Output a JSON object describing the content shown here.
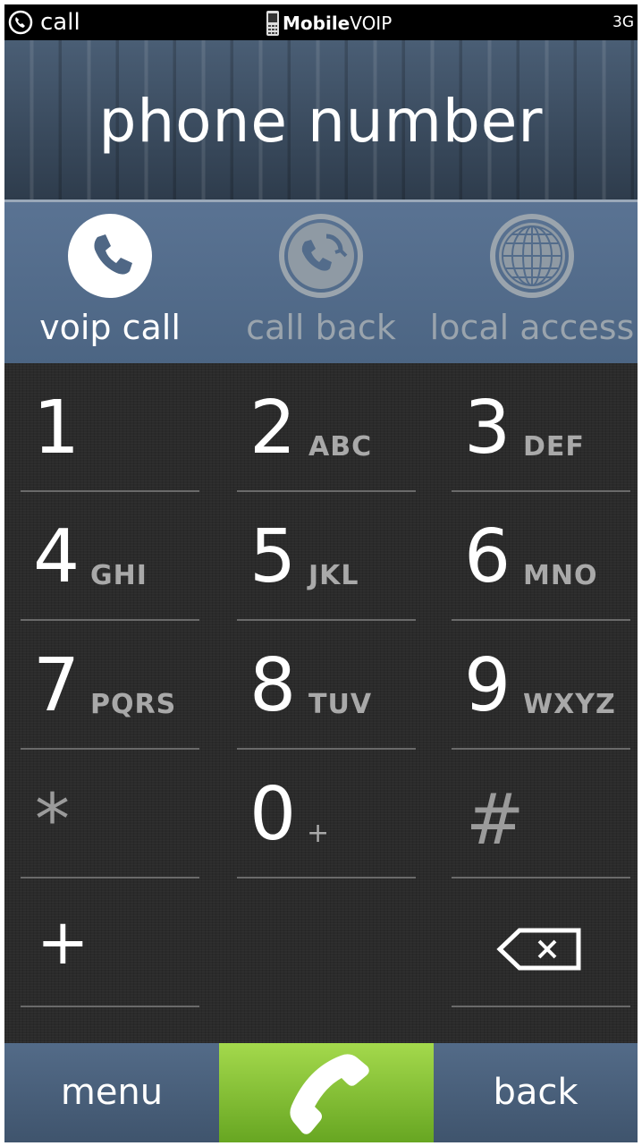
{
  "status_bar": {
    "app_label": "call",
    "brand_bold": "Mobile",
    "brand_light": "VOIP",
    "network": "3G"
  },
  "header": {
    "title": "phone number"
  },
  "modes": [
    {
      "label": "voip call",
      "icon": "phone-icon",
      "active": true
    },
    {
      "label": "call back",
      "icon": "callback-icon",
      "active": false
    },
    {
      "label": "local access",
      "icon": "globe-icon",
      "active": false
    }
  ],
  "keypad": {
    "keys": [
      {
        "digit": "1",
        "letters": ""
      },
      {
        "digit": "2",
        "letters": "ABC"
      },
      {
        "digit": "3",
        "letters": "DEF"
      },
      {
        "digit": "4",
        "letters": "GHI"
      },
      {
        "digit": "5",
        "letters": "JKL"
      },
      {
        "digit": "6",
        "letters": "MNO"
      },
      {
        "digit": "7",
        "letters": "PQRS"
      },
      {
        "digit": "8",
        "letters": "TUV"
      },
      {
        "digit": "9",
        "letters": "WXYZ"
      },
      {
        "digit": "*",
        "letters": ""
      },
      {
        "digit": "0",
        "letters": "+"
      },
      {
        "digit": "#",
        "letters": ""
      }
    ],
    "plus_key": "+",
    "backspace_icon": "backspace-icon"
  },
  "bottom_bar": {
    "menu_label": "menu",
    "call_icon": "phone-handset-icon",
    "back_label": "back"
  },
  "colors": {
    "header": "#3c4d62",
    "mode_bar": "#536c8b",
    "keypad_bg": "#2b2b2b",
    "call_button": "#8cc63f"
  }
}
